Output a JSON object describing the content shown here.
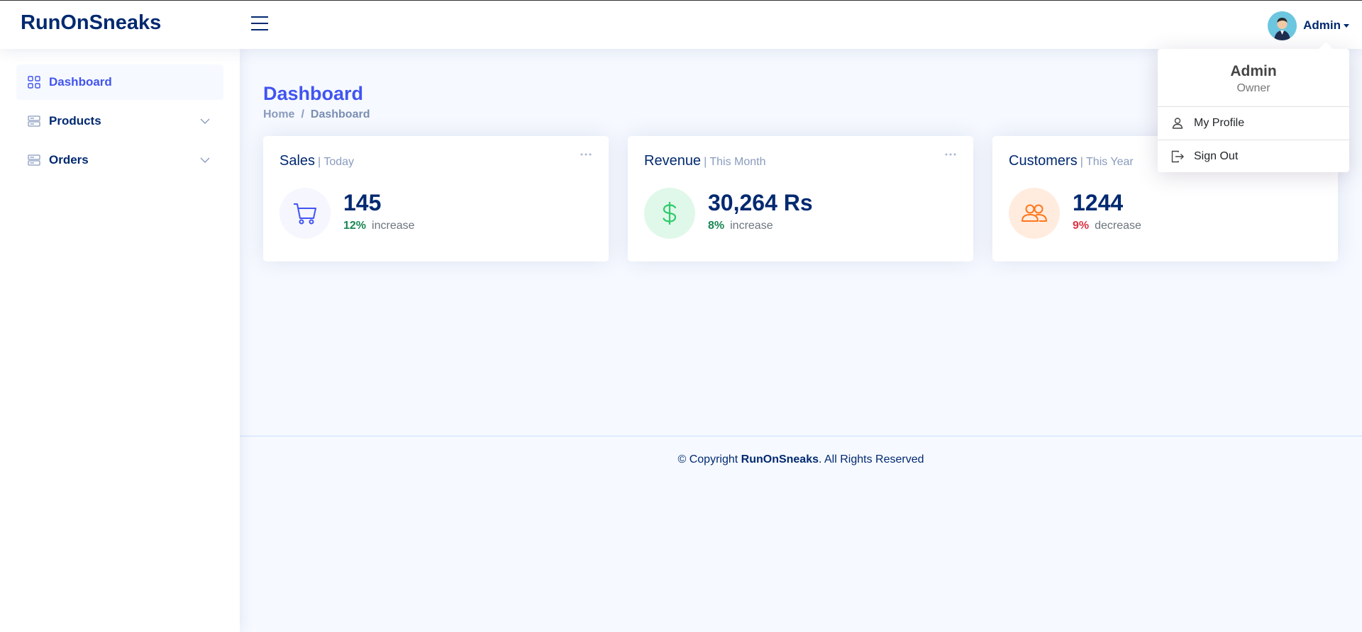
{
  "header": {
    "logo": "RunOnSneaks",
    "profile_name": "Admin"
  },
  "profile_dropdown": {
    "name": "Admin",
    "role": "Owner",
    "items": [
      {
        "label": "My Profile",
        "icon": "person-icon"
      },
      {
        "label": "Sign Out",
        "icon": "sign-out-icon"
      }
    ]
  },
  "sidebar": {
    "items": [
      {
        "label": "Dashboard",
        "icon": "grid-icon",
        "active": true
      },
      {
        "label": "Products",
        "icon": "server-icon",
        "expandable": true
      },
      {
        "label": "Orders",
        "icon": "server-icon",
        "expandable": true
      }
    ]
  },
  "page": {
    "title": "Dashboard",
    "breadcrumb": [
      "Home",
      "Dashboard"
    ]
  },
  "cards": [
    {
      "title": "Sales",
      "period": "| Today",
      "value": "145",
      "change_pct": "12%",
      "change_word": "increase",
      "trend": "up",
      "icon": "cart-icon",
      "icon_bg": "#f6f6fe",
      "icon_color": "#4154f1"
    },
    {
      "title": "Revenue",
      "period": "| This Month",
      "value": "30,264 Rs",
      "change_pct": "8%",
      "change_word": "increase",
      "trend": "up",
      "icon": "dollar-icon",
      "icon_bg": "#e0f8e9",
      "icon_color": "#2eca6a"
    },
    {
      "title": "Customers",
      "period": "| This Year",
      "value": "1244",
      "change_pct": "9%",
      "change_word": "decrease",
      "trend": "down",
      "icon": "people-icon",
      "icon_bg": "#ffecdf",
      "icon_color": "#ff771d"
    }
  ],
  "footer": {
    "prefix": "© Copyright ",
    "brand": "RunOnSneaks",
    "suffix": ". All Rights Reserved"
  }
}
